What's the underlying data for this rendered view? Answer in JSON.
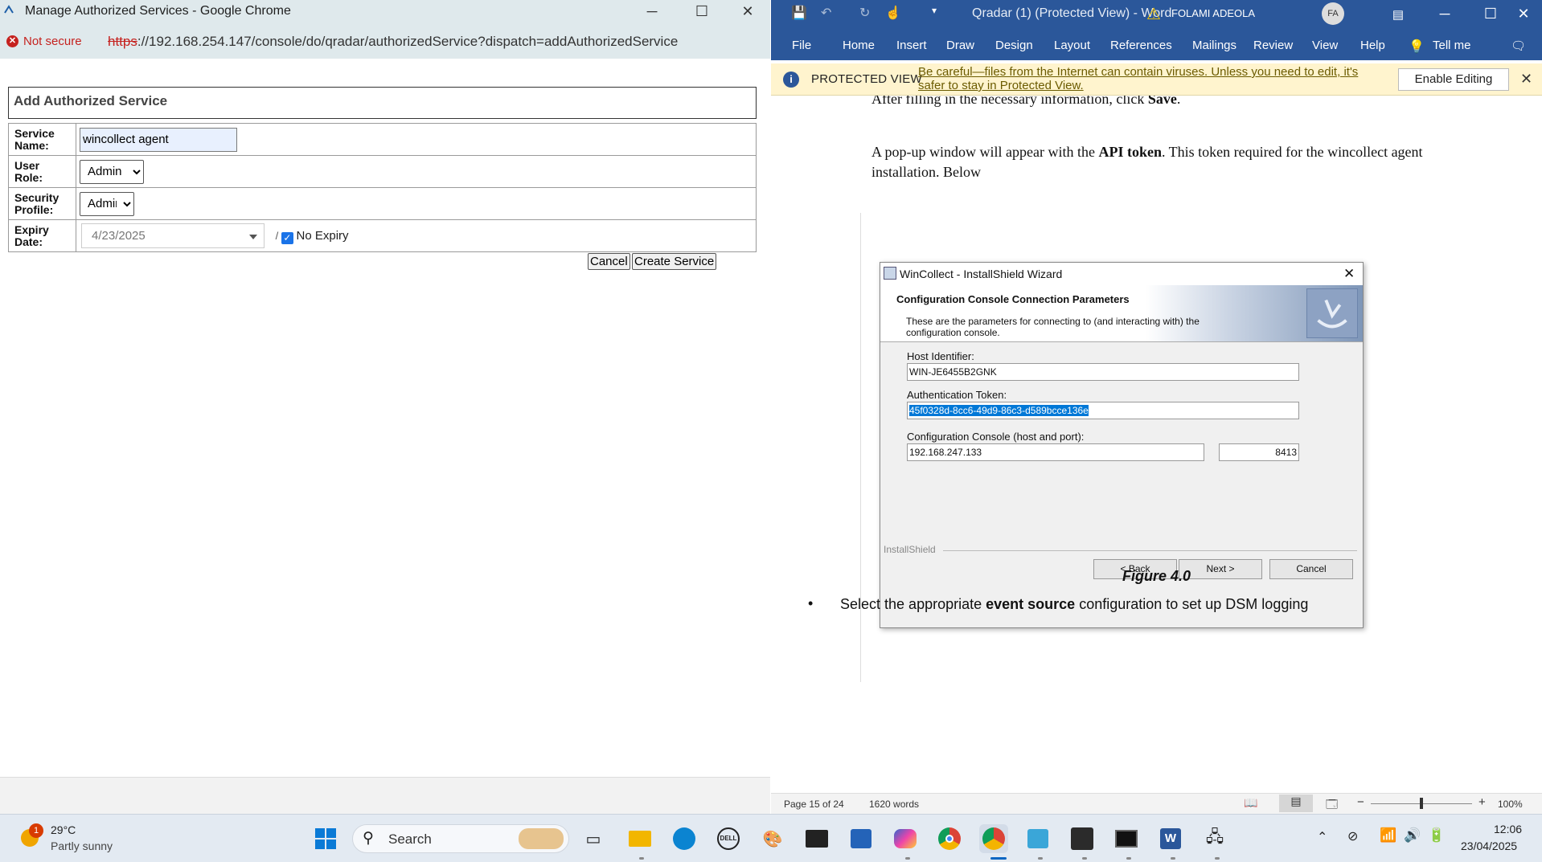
{
  "chrome": {
    "title": "Manage Authorized Services - Google Chrome",
    "security": "Not secure",
    "url_scheme": "https",
    "url_rest": "://192.168.254.147/console/do/qradar/authorizedService?dispatch=addAuthorizedService"
  },
  "form": {
    "heading": "Add Authorized Service",
    "service_name_label": "Service Name:",
    "service_name_value": "wincollect agent",
    "user_role_label": "User Role:",
    "user_role_value": "Admin",
    "security_profile_label": "Security Profile:",
    "security_profile_value": "Admin",
    "expiry_label": "Expiry Date:",
    "expiry_value": "4/23/2025",
    "expiry_sep": "/",
    "no_expiry_label": "No Expiry",
    "no_expiry_checked": true,
    "cancel_label": "Cancel",
    "create_label": "Create Service"
  },
  "word": {
    "title": "Qradar (1) (Protected View) - Word",
    "user_name": "FOLAMI ADEOLA",
    "user_initials": "FA",
    "tabs": [
      "File",
      "Home",
      "Insert",
      "Draw",
      "Design",
      "Layout",
      "References",
      "Mailings",
      "Review",
      "View",
      "Help",
      "Tell me"
    ],
    "protected_label": "PROTECTED VIEW",
    "protected_msg": "Be careful—files from the Internet can contain viruses. Unless you need to edit, it's safer to stay in Protected View.",
    "enable_editing": "Enable Editing",
    "p1_pre": "After filling in the necessary information, click ",
    "p1_bold": "Save",
    "p1_post": ".",
    "p2_pre": " A pop-up window will appear with the ",
    "p2_bold": "API token",
    "p2_post": ". This token required for the wincollect agent installation. Below",
    "figure_caption": "Figure 4.0",
    "bullet_pre": "Select the appropriate ",
    "bullet_bold": "event source",
    "bullet_post": " configuration to set up DSM logging",
    "status_page": "Page 15 of 24",
    "status_words": "1620 words",
    "zoom": "100%"
  },
  "installshield": {
    "title": "WinCollect - InstallShield Wizard",
    "heading": "Configuration Console Connection Parameters",
    "subheading": "These are the parameters for connecting to (and interacting with) the configuration console.",
    "host_label": "Host Identifier:",
    "host_value": "WIN-JE6455B2GNK",
    "token_label": "Authentication Token:",
    "token_value": "45f0328d-8cc6-49d9-86c3-d589bcce136e",
    "console_label": "Configuration Console (host and port):",
    "console_host": "192.168.247.133",
    "console_port": "8413",
    "brand": "InstallShield",
    "back": "< Back",
    "next": "Next >",
    "cancel": "Cancel"
  },
  "taskbar": {
    "weather_temp": "29°C",
    "weather_desc": "Partly sunny",
    "weather_badge": "1",
    "search": "Search",
    "time": "12:06",
    "date": "23/04/2025"
  }
}
